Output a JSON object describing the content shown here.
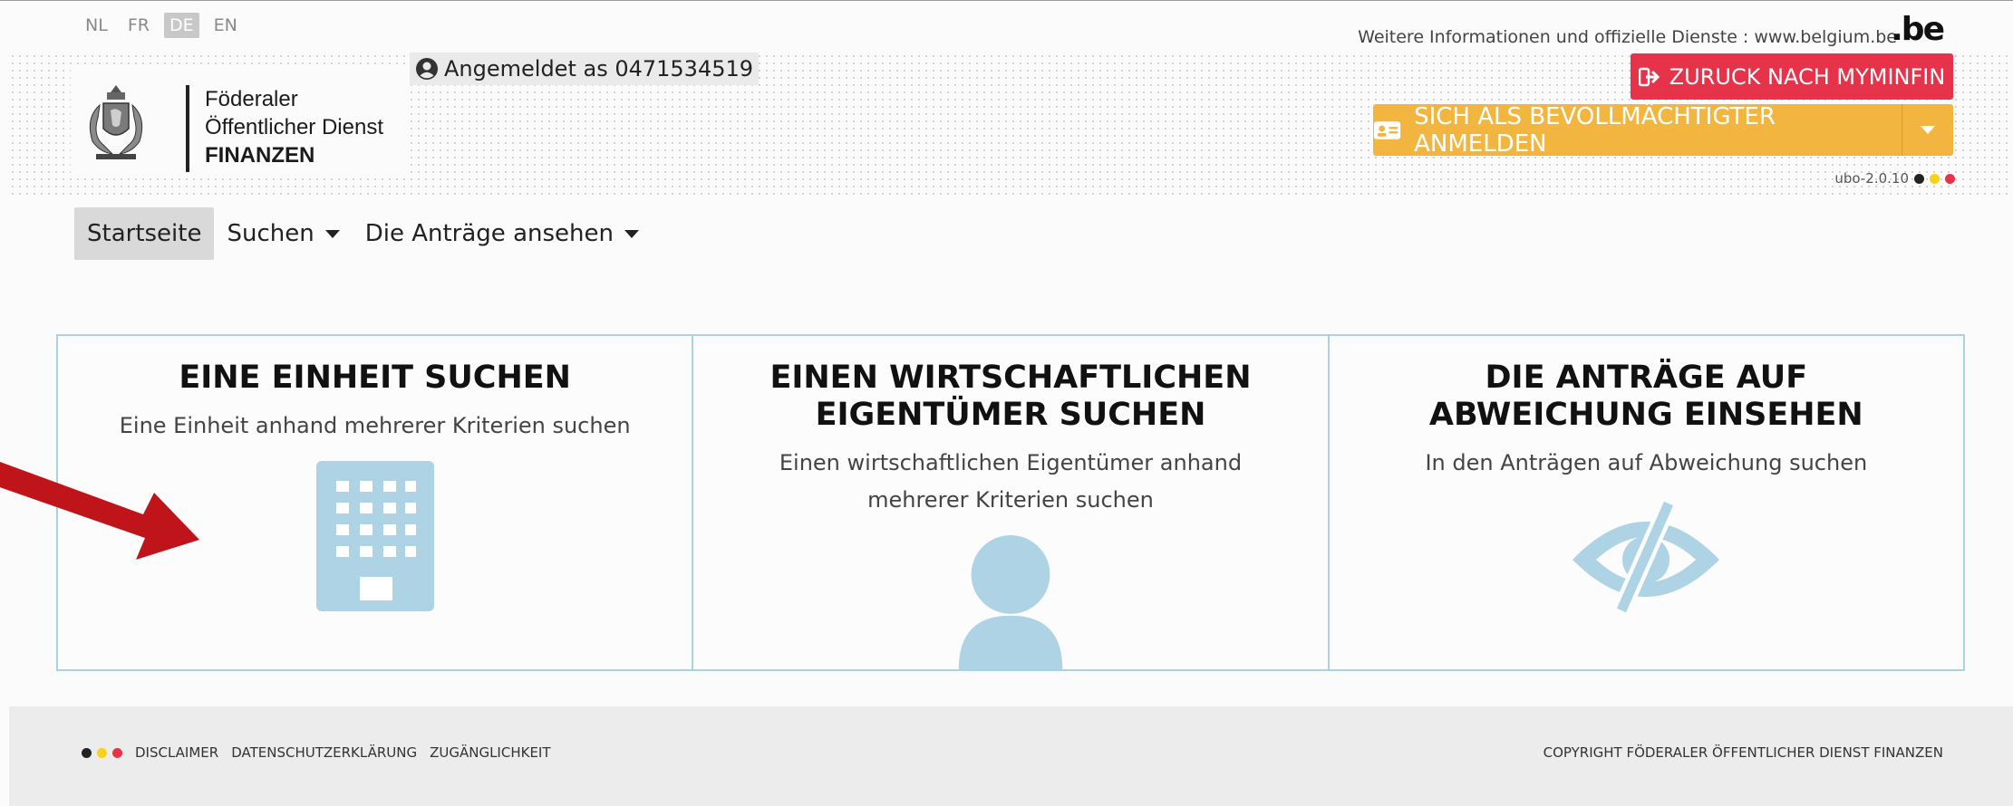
{
  "languages": [
    {
      "code": "NL",
      "active": false
    },
    {
      "code": "FR",
      "active": false
    },
    {
      "code": "DE",
      "active": true
    },
    {
      "code": "EN",
      "active": false
    }
  ],
  "logo": {
    "line1": "Föderaler",
    "line2": "Öffentlicher Dienst",
    "line3": "FINANZEN"
  },
  "logged_in": "Angemeldet as 0471534519",
  "info_text": "Weitere Informationen und offizielle Dienste : www.belgium.be",
  "be_logo": ".be",
  "buttons": {
    "back": "ZURUCK NACH MYMINFIN",
    "proxy": "SICH ALS BEVOLLMÄCHTIGTER ANMELDEN"
  },
  "version": "ubo-2.0.10",
  "nav": [
    {
      "label": "Startseite",
      "active": true,
      "dropdown": false
    },
    {
      "label": "Suchen",
      "active": false,
      "dropdown": true
    },
    {
      "label": "Die Anträge ansehen",
      "active": false,
      "dropdown": true
    }
  ],
  "cards": [
    {
      "title": "EINE EINHEIT SUCHEN",
      "desc": "Eine Einheit anhand mehrerer Kriterien suchen",
      "icon": "building-icon"
    },
    {
      "title": "EINEN WIRTSCHAFTLICHEN EIGENTÜMER SUCHEN",
      "desc": "Einen wirtschaftlichen Eigentümer anhand mehrerer Kriterien suchen",
      "icon": "user-icon"
    },
    {
      "title": "DIE ANTRÄGE AUF ABWEICHUNG EINSEHEN",
      "desc": "In den Anträgen auf Abweichung suchen",
      "icon": "eye-slash-icon"
    }
  ],
  "footer": {
    "links": [
      "DISCLAIMER",
      "DATENSCHUTZERKLÄRUNG",
      "ZUGÄNGLICHKEIT"
    ],
    "copyright": "COPYRIGHT FÖDERALER ÖFFENTLICHER DIENST FINANZEN"
  },
  "colors": {
    "accent_blue": "#a9d2e2",
    "red": "#e6334a",
    "yellow": "#f2b640",
    "flag_black": "#222222",
    "flag_yellow": "#f6d21a",
    "flag_red": "#e6334a"
  }
}
